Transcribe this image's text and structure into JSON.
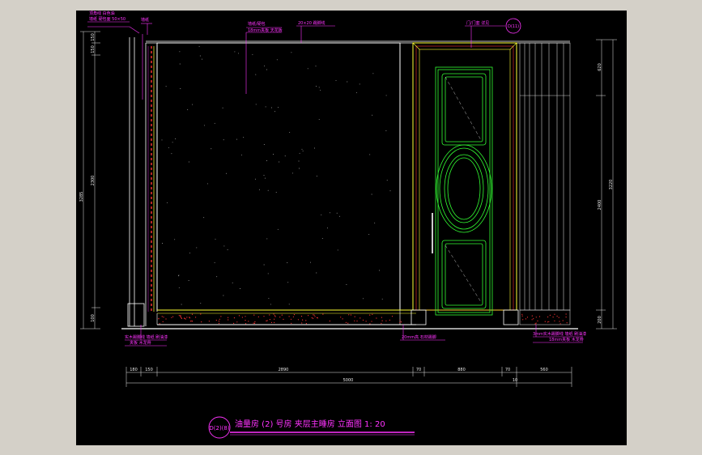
{
  "colors": {
    "background": "#000000",
    "frame": "#d4d0c8",
    "annotation": "#ff33ff",
    "wall": "#ffffff",
    "door_green": "#33ff33",
    "door_yellow": "#ffff33",
    "door_red": "#ff3333",
    "dimension": "#e8e8e8"
  },
  "annotations": {
    "top_left_1": "顶角线 白色油",
    "top_left_2": "墙纸 硬包面 50×50",
    "top_left_3": "墙纸",
    "top_center_1": "墙纸/硬包",
    "top_center_2": "18mm夹板 天花板",
    "top_center_3": "20×20 踢脚线",
    "top_right_door": "门/门套 详见",
    "top_right_tag": "D(11)",
    "bottom_left_1": "实木踢脚线 墙纸 刷油漆",
    "bottom_left_2": "夹板 木龙骨",
    "bottom_center": "20mm高 石材踢脚",
    "bottom_right_1": "3mm实木踢脚线 墙纸 刷油漆",
    "bottom_right_2": "18mm夹板 木龙骨"
  },
  "dims_left": {
    "d1": "150",
    "d2": "150",
    "d3": "2300",
    "d4": "100",
    "total": "3285"
  },
  "dims_right": {
    "d1": "620",
    "d2": "2400",
    "d3": "200",
    "total": "3220"
  },
  "dims_bottom": {
    "d1": "180",
    "d2": "150",
    "d3": "2890",
    "d4": "70",
    "d5": "880",
    "d6": "70",
    "d7": "560",
    "total": "5000",
    "total2": "10"
  },
  "title": {
    "tag": "D(2)(8)",
    "text": "油量房 (2) 号房 夹层主睡房 立面图  1: 20"
  }
}
